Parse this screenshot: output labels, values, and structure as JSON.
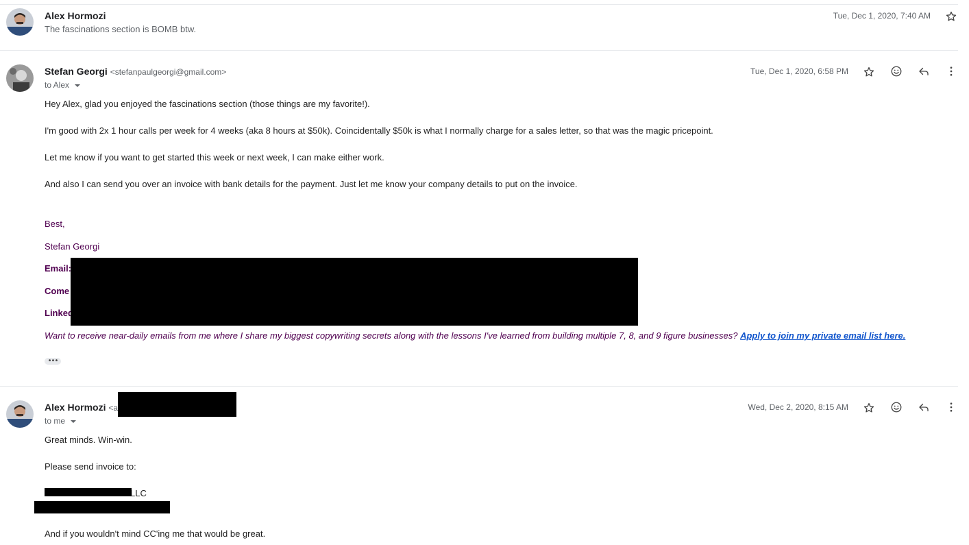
{
  "messages": [
    {
      "sender": "Alex Hormozi",
      "snippet": "The fascinations section is BOMB btw.",
      "date": "Tue, Dec 1, 2020, 7:40 AM"
    },
    {
      "sender": "Stefan Georgi",
      "email": "<stefanpaulgeorgi@gmail.com>",
      "date": "Tue, Dec 1, 2020, 6:58 PM",
      "to": "to Alex",
      "body": [
        "Hey Alex, glad you enjoyed the fascinations section (those things are my favorite!).",
        "I'm good with 2x 1 hour calls per week for 4 weeks (aka 8 hours at $50k). Coincidentally $50k is what I normally charge for a sales letter, so that was the magic pricepoint.",
        "Let me know if you want to get started this week or next week, I can make either work.",
        "And also I can send you over an invoice with bank details for the payment. Just let me know your company details to put on the invoice."
      ],
      "signature": {
        "closing": "Best,",
        "name": "Stefan Georgi",
        "email_label": "Email:",
        "come_label": "Come",
        "linked_label": "Linked"
      },
      "promo_text": "Want to receive near-daily emails from me where I share my biggest copywriting secrets along with the lessons I've learned from building multiple 7, 8, and 9 figure businesses?",
      "promo_link": "Apply to join my private email list here. ",
      "ellipsis": "•••"
    },
    {
      "sender": "Alex Hormozi",
      "email_partial": "<a",
      "date": "Wed, Dec 2, 2020, 8:15 AM",
      "to": "to me",
      "body": [
        "Great minds. Win-win.",
        "Please send invoice to:",
        "LLC",
        "And if you wouldn't mind CC'ing me that would be great."
      ]
    }
  ],
  "icons": {
    "star": "star-icon",
    "emoji": "emoji-icon",
    "reply": "reply-icon",
    "more": "more-vert-icon",
    "dropdown": "caret-down-icon"
  },
  "colors": {
    "signature": "#500050",
    "link": "#1155cc",
    "redaction": "#000000"
  }
}
